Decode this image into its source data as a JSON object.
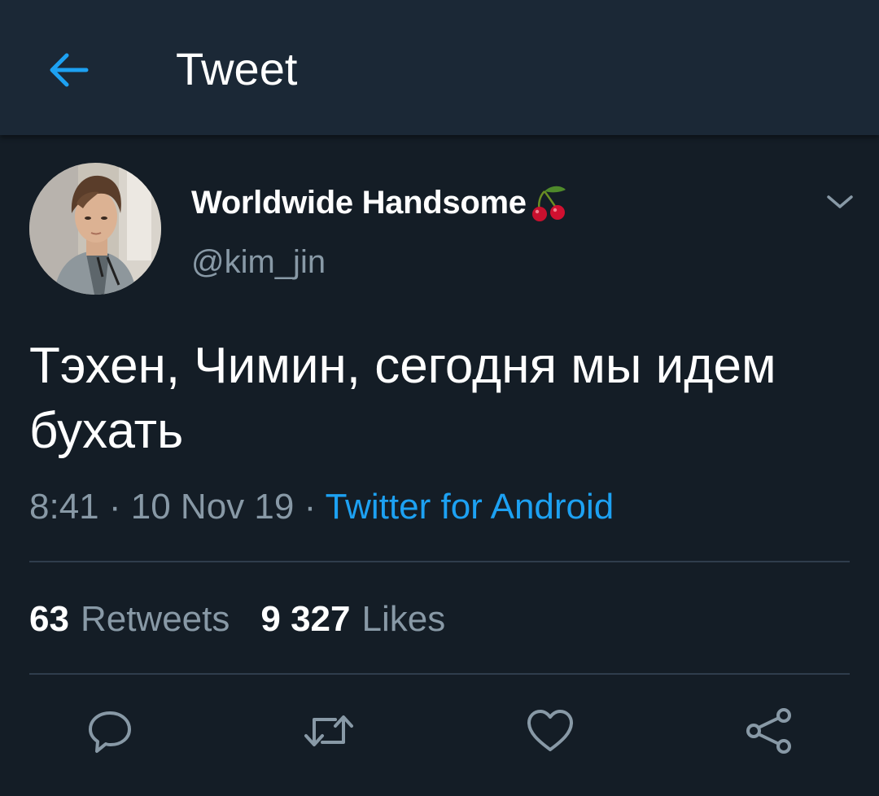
{
  "header": {
    "title": "Tweet",
    "back_icon": "arrow-left-icon"
  },
  "colors": {
    "background": "#141d26",
    "header_background": "#1b2836",
    "accent": "#1da1f2",
    "secondary_text": "#8899a6",
    "divider": "#2f3d4c"
  },
  "author": {
    "display_name": "Worldwide Handsome",
    "name_emoji": "cherries-icon",
    "handle": "@kim_jin"
  },
  "tweet": {
    "text": "Тэхен, Чимин, сегодня мы идем бухать",
    "time": "8:41",
    "separator": "·",
    "date": "10 Nov 19",
    "source": "Twitter for Android"
  },
  "stats": {
    "retweets_count": "63",
    "retweets_label": "Retweets",
    "likes_count": "9 327",
    "likes_label": "Likes"
  },
  "actions": [
    "reply-icon",
    "retweet-icon",
    "like-icon",
    "share-icon"
  ]
}
